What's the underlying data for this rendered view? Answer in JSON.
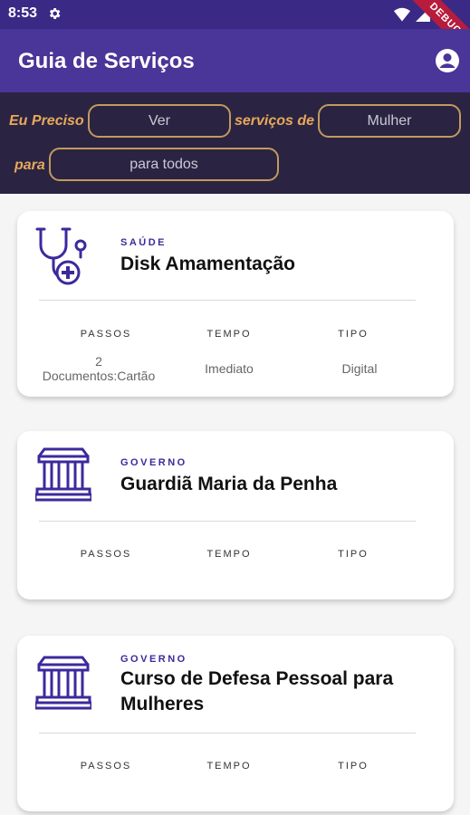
{
  "status_bar": {
    "time": "8:53",
    "debug_label": "DEBUG"
  },
  "app_bar": {
    "title": "Guia de Serviços"
  },
  "filter": {
    "label_need": "Eu Preciso",
    "need_value": "Ver",
    "label_services_of": "serviços de",
    "audience_value": "Mulher",
    "label_for": "para",
    "scope_value": "para todos"
  },
  "columns": {
    "steps": "PASSOS",
    "time": "TEMPO",
    "type": "TIPO"
  },
  "cards": [
    {
      "category": "SAÚDE",
      "title": "Disk Amamentação",
      "icon": "stethoscope-icon",
      "steps": "2\nDocumentos:Cartão",
      "time": "Imediato",
      "type": "Digital"
    },
    {
      "category": "GOVERNO",
      "title": "Guardiã Maria da Penha",
      "icon": "government-building-icon",
      "steps": "",
      "time": "",
      "type": ""
    },
    {
      "category": "GOVERNO",
      "title": "Curso de Defesa Pessoal para Mulheres",
      "icon": "government-building-icon",
      "steps": "",
      "time": "",
      "type": ""
    }
  ],
  "colors": {
    "primary": "#4a3598",
    "status": "#3a2a86",
    "filter_bg": "#2a2442",
    "accent": "#e8a95a",
    "category": "#3b2a9c"
  }
}
